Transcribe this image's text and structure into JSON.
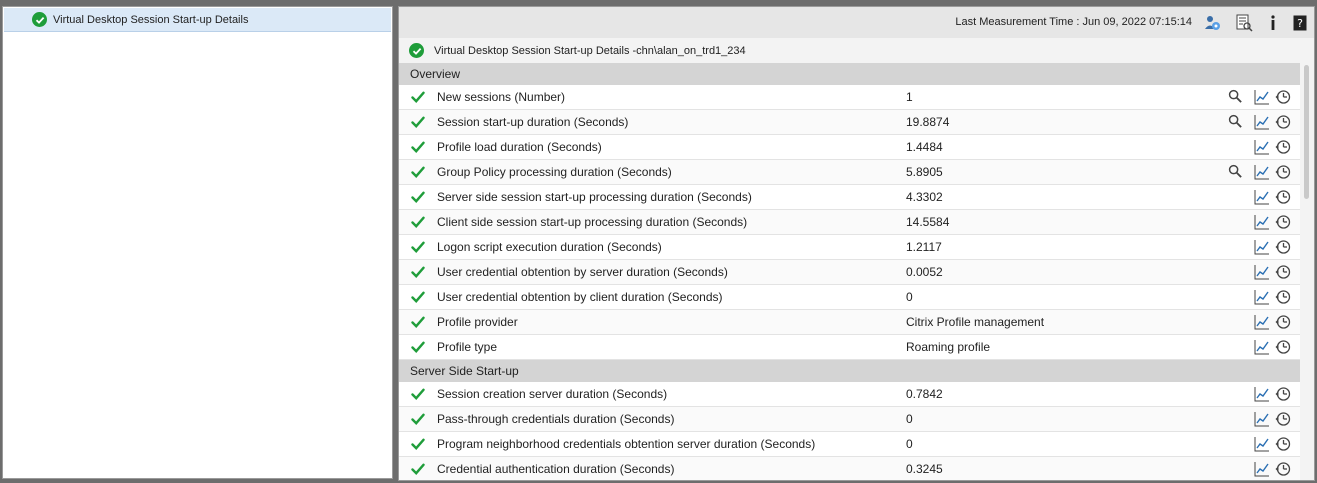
{
  "tree": {
    "item_label": "Virtual Desktop Session Start-up Details"
  },
  "toolbar": {
    "measurement_text": "Last Measurement Time : Jun 09, 2022 07:15:14",
    "icons": [
      "user-settings-icon",
      "report-icon",
      "info-icon",
      "help-icon"
    ]
  },
  "panel": {
    "title": "Virtual Desktop Session Start-up Details -chn\\alan_on_trd1_234"
  },
  "sections": [
    {
      "title": "Overview",
      "rows": [
        {
          "name": "New sessions (Number)",
          "value": "1",
          "search": true
        },
        {
          "name": "Session start-up duration (Seconds)",
          "value": "19.8874",
          "search": true
        },
        {
          "name": "Profile load duration (Seconds)",
          "value": "1.4484",
          "search": false
        },
        {
          "name": "Group Policy processing duration (Seconds)",
          "value": "5.8905",
          "search": true
        },
        {
          "name": "Server side session start-up processing duration (Seconds)",
          "value": "4.3302",
          "search": false
        },
        {
          "name": "Client side session start-up processing duration (Seconds)",
          "value": "14.5584",
          "search": false
        },
        {
          "name": "Logon script execution duration (Seconds)",
          "value": "1.2117",
          "search": false
        },
        {
          "name": "User credential obtention by server duration (Seconds)",
          "value": "0.0052",
          "search": false
        },
        {
          "name": "User credential obtention by client duration (Seconds)",
          "value": "0",
          "search": false
        },
        {
          "name": "Profile provider",
          "value": "Citrix Profile management",
          "search": false
        },
        {
          "name": "Profile type",
          "value": "Roaming profile",
          "search": false
        }
      ]
    },
    {
      "title": "Server Side Start-up",
      "rows": [
        {
          "name": "Session creation server duration (Seconds)",
          "value": "0.7842",
          "search": false
        },
        {
          "name": "Pass-through credentials duration (Seconds)",
          "value": "0",
          "search": false
        },
        {
          "name": "Program neighborhood credentials obtention server duration (Seconds)",
          "value": "0",
          "search": false
        },
        {
          "name": "Credential authentication duration (Seconds)",
          "value": "0.3245",
          "search": false
        }
      ]
    }
  ],
  "colors": {
    "ok_green": "#1f9d3a",
    "selection_blue": "#dbe9f7",
    "section_gray": "#d4d4d4",
    "icon_blue": "#2a6fb3"
  }
}
